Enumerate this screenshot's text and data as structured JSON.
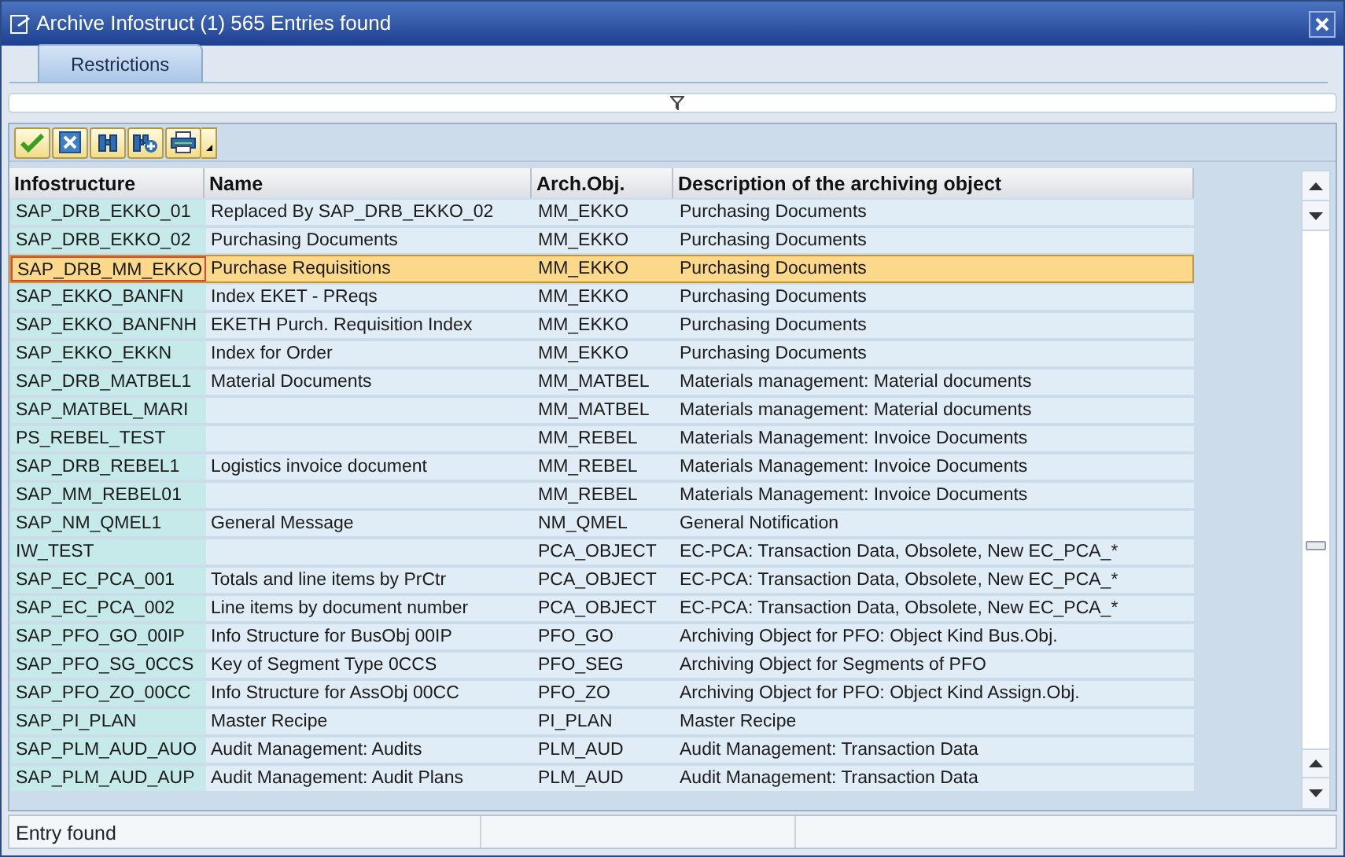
{
  "window": {
    "title": "Archive Infostruct (1)  565 Entries found"
  },
  "tabs": [
    {
      "label": "Restrictions",
      "selected": true
    }
  ],
  "toolbar": [
    {
      "kind": "check"
    },
    {
      "kind": "cancel"
    },
    {
      "kind": "find"
    },
    {
      "kind": "find-next"
    },
    {
      "kind": "print"
    }
  ],
  "table": {
    "columns": [
      "Infostructure",
      "Name",
      "Arch.Obj.",
      "Description of the archiving object"
    ],
    "rows": [
      {
        "cells": [
          "SAP_DRB_EKKO_01",
          "Replaced By SAP_DRB_EKKO_02",
          "MM_EKKO",
          "Purchasing Documents"
        ],
        "selected": false
      },
      {
        "cells": [
          "SAP_DRB_EKKO_02",
          "Purchasing Documents",
          "MM_EKKO",
          "Purchasing Documents"
        ],
        "selected": false
      },
      {
        "cells": [
          "SAP_DRB_MM_EKKO",
          "Purchase Requisitions",
          "MM_EKKO",
          "Purchasing Documents"
        ],
        "selected": true
      },
      {
        "cells": [
          "SAP_EKKO_BANFN",
          "Index EKET - PReqs",
          "MM_EKKO",
          "Purchasing Documents"
        ],
        "selected": false
      },
      {
        "cells": [
          "SAP_EKKO_BANFNH",
          "EKETH Purch. Requisition Index",
          "MM_EKKO",
          "Purchasing Documents"
        ],
        "selected": false
      },
      {
        "cells": [
          "SAP_EKKO_EKKN",
          "Index for Order",
          "MM_EKKO",
          "Purchasing Documents"
        ],
        "selected": false
      },
      {
        "cells": [
          "SAP_DRB_MATBEL1",
          "Material Documents",
          "MM_MATBEL",
          "Materials management: Material documents"
        ],
        "selected": false
      },
      {
        "cells": [
          "SAP_MATBEL_MARI",
          "",
          "MM_MATBEL",
          "Materials management: Material documents"
        ],
        "selected": false
      },
      {
        "cells": [
          "PS_REBEL_TEST",
          "",
          "MM_REBEL",
          "Materials Management: Invoice Documents"
        ],
        "selected": false
      },
      {
        "cells": [
          "SAP_DRB_REBEL1",
          "Logistics invoice document",
          "MM_REBEL",
          "Materials Management: Invoice Documents"
        ],
        "selected": false
      },
      {
        "cells": [
          "SAP_MM_REBEL01",
          "",
          "MM_REBEL",
          "Materials Management: Invoice Documents"
        ],
        "selected": false
      },
      {
        "cells": [
          "SAP_NM_QMEL1",
          "General Message",
          "NM_QMEL",
          "General Notification"
        ],
        "selected": false
      },
      {
        "cells": [
          "IW_TEST",
          "",
          "PCA_OBJECT",
          "EC-PCA: Transaction Data, Obsolete, New EC_PCA_*"
        ],
        "selected": false
      },
      {
        "cells": [
          "SAP_EC_PCA_001",
          "Totals and line items by PrCtr",
          "PCA_OBJECT",
          "EC-PCA: Transaction Data, Obsolete, New EC_PCA_*"
        ],
        "selected": false
      },
      {
        "cells": [
          "SAP_EC_PCA_002",
          "Line items by document number",
          "PCA_OBJECT",
          "EC-PCA: Transaction Data, Obsolete, New EC_PCA_*"
        ],
        "selected": false
      },
      {
        "cells": [
          "SAP_PFO_GO_00IP",
          "Info Structure for BusObj 00IP",
          "PFO_GO",
          "Archiving Object for PFO: Object Kind Bus.Obj."
        ],
        "selected": false
      },
      {
        "cells": [
          "SAP_PFO_SG_0CCS",
          "Key of Segment Type 0CCS",
          "PFO_SEG",
          "Archiving Object for Segments of PFO"
        ],
        "selected": false
      },
      {
        "cells": [
          "SAP_PFO_ZO_00CC",
          "Info Structure for AssObj 00CC",
          "PFO_ZO",
          "Archiving Object for PFO: Object Kind Assign.Obj."
        ],
        "selected": false
      },
      {
        "cells": [
          "SAP_PI_PLAN",
          "Master Recipe",
          "PI_PLAN",
          "Master Recipe"
        ],
        "selected": false
      },
      {
        "cells": [
          "SAP_PLM_AUD_AUO",
          "Audit Management: Audits",
          "PLM_AUD",
          "Audit Management: Transaction Data"
        ],
        "selected": false
      },
      {
        "cells": [
          "SAP_PLM_AUD_AUP",
          "Audit Management: Audit Plans",
          "PLM_AUD",
          "Audit Management: Transaction Data"
        ],
        "selected": false
      }
    ]
  },
  "status_bar": {
    "message": "Entry found"
  }
}
